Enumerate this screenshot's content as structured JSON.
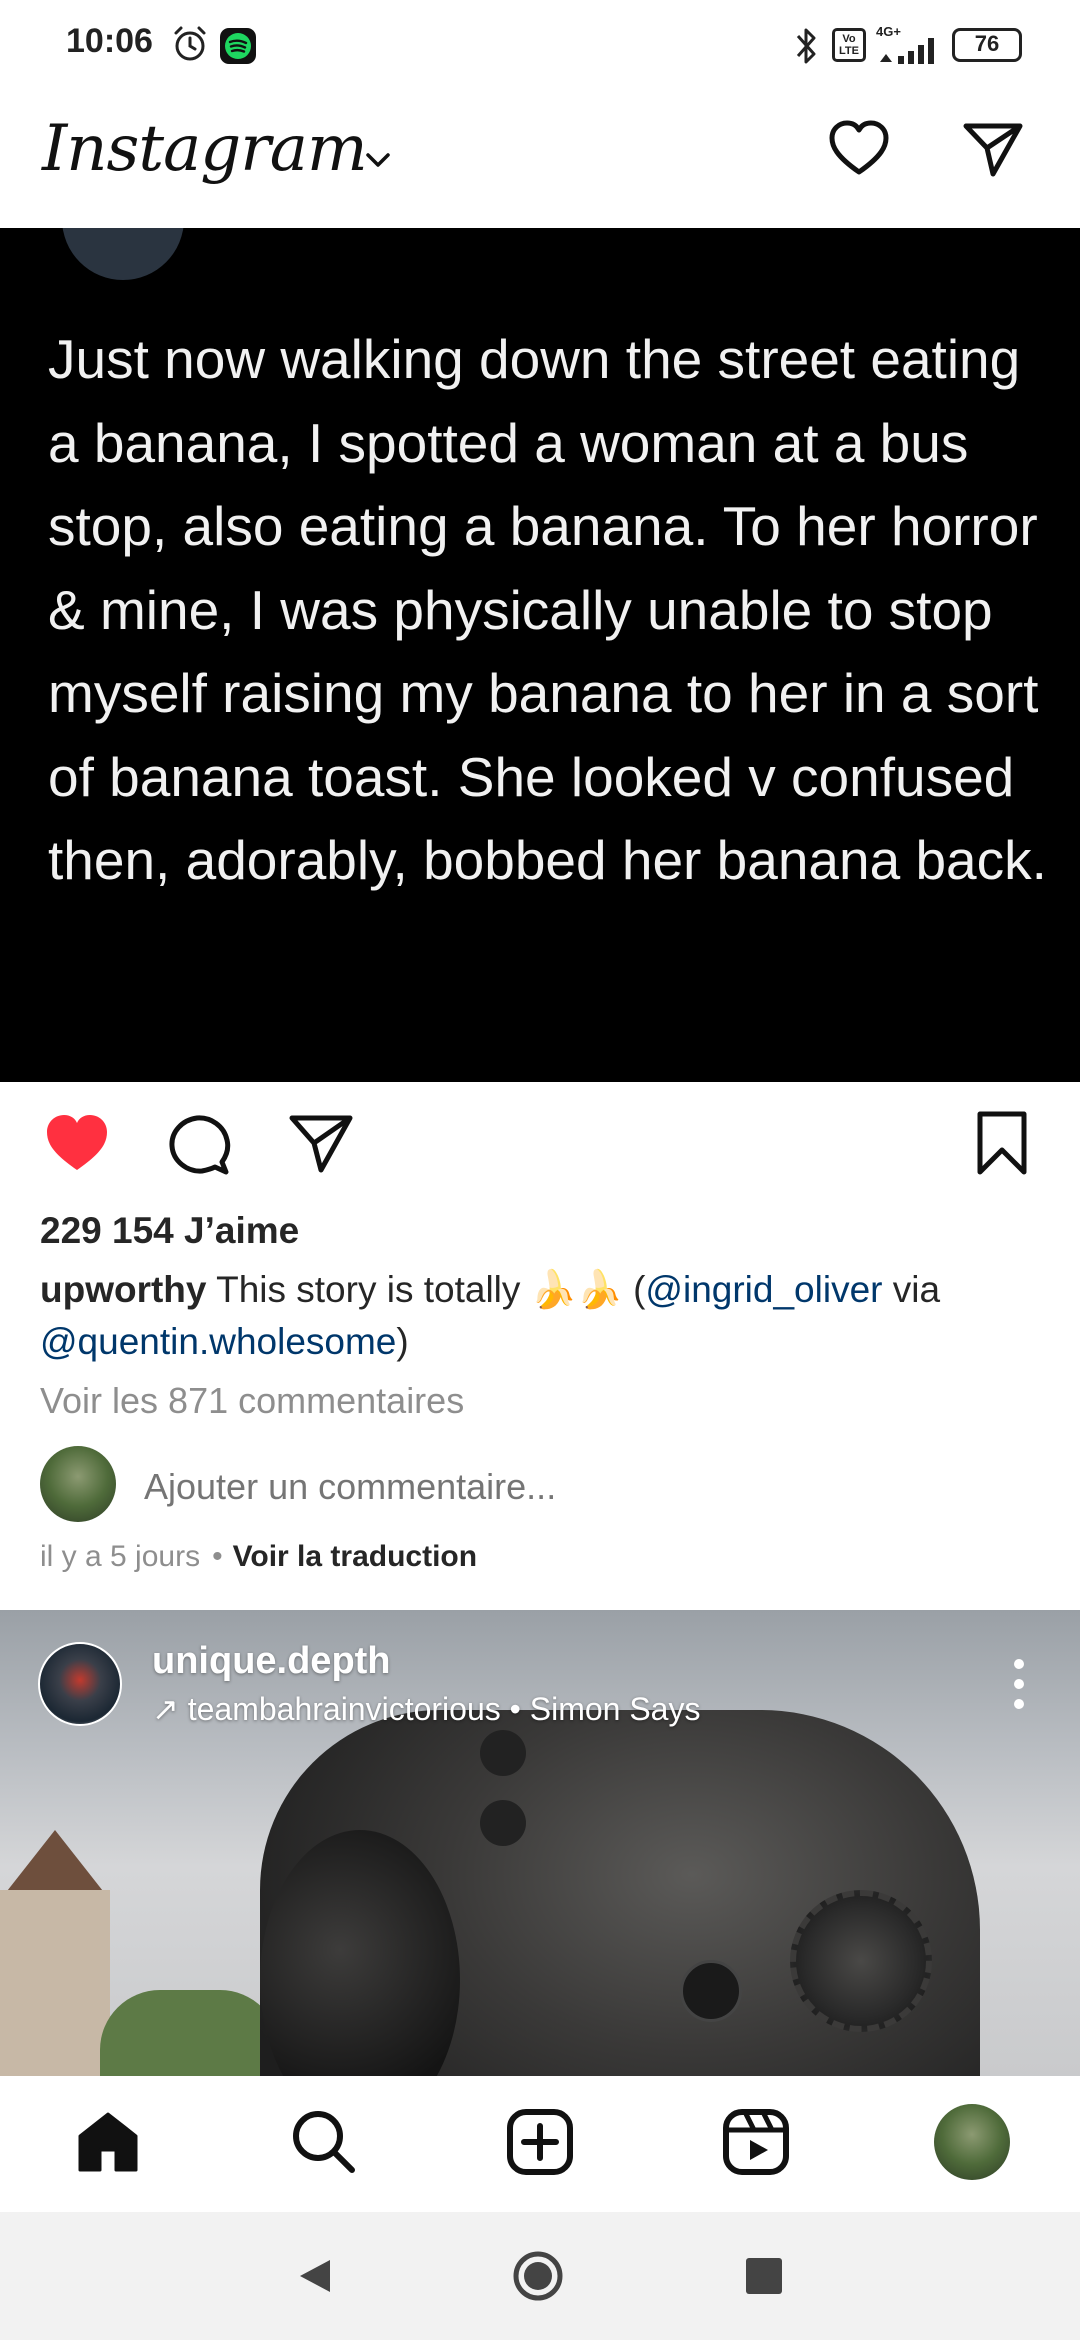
{
  "status_bar": {
    "time": "10:06",
    "network": "4G+",
    "volte": "Vo LTE",
    "battery": "76"
  },
  "top_bar": {
    "logo": "Instagram"
  },
  "post": {
    "tweet_text": "Just now walking down the street eating a banana, I spotted a woman at a bus stop, also eating a banana. To her horror & mine, I was physically unable to stop myself raising my banana to her in a sort of banana toast. She looked v confused then, adorably, bobbed her banana back.",
    "liked": true,
    "likes_text": "229 154 J’aime",
    "caption": {
      "username": "upworthy",
      "text_before": " This story is totally 🍌🍌 (",
      "mention_1": "@ingrid_oliver",
      "text_middle": " via ",
      "mention_2": "@quentin.wholesome",
      "text_after": ")"
    },
    "view_comments": "Voir les 871 commentaires",
    "comment_placeholder": "Ajouter un commentaire...",
    "time_ago": "il y a 5 jours",
    "dot": "•",
    "translate": "Voir la traduction"
  },
  "next_post": {
    "username": "unique.depth",
    "subtitle": "↗ teambahrainvictorious • Simon Says"
  },
  "colors": {
    "like_red": "#ff3040",
    "mention_blue": "#00376b",
    "text_dark": "#262626",
    "text_gray": "#8e8e8e"
  }
}
